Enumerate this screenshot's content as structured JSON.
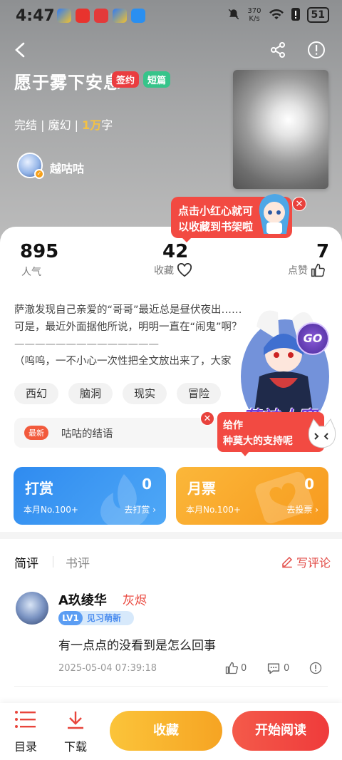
{
  "status_bar": {
    "time": "4:47",
    "net_speed_value": "370",
    "net_speed_unit": "K/s",
    "battery": "51"
  },
  "book": {
    "title": "愿于雾下安息",
    "tag_signed": "签约",
    "tag_short": "短篇",
    "status": "完结",
    "genre": "魔幻",
    "word_count_num": "1万",
    "word_count_unit": "字",
    "author": "越咕咕"
  },
  "stats": {
    "popularity_value": "895",
    "popularity_label": "人气",
    "collect_value": "42",
    "collect_label": "收藏",
    "like_value": "7",
    "like_label": "点赞"
  },
  "tooltip_collect": {
    "line1": "点击小红心就可",
    "line2": "以收藏到书架啦"
  },
  "synopsis": {
    "line1": "萨澈发现自己亲爱的“哥哥”最近总是昼伏夜出……",
    "line2": "可是，最近外面据他所说，明明一直在“闹鬼”啊？",
    "line3": "——————————————",
    "line4": "（呜呜，一不小心一次性把全文放出来了，大家"
  },
  "tags": [
    "西幻",
    "脑洞",
    "现实",
    "冒险"
  ],
  "latest_chapter": {
    "badge": "最新",
    "title": "咕咕的结语"
  },
  "promo": {
    "label": "萌神大赛",
    "go": "GO",
    "tip_line1": "给作",
    "tip_line2": "种莫大的支持呢"
  },
  "reward": {
    "title": "打赏",
    "count": "0",
    "rank": "本月No.100+",
    "action": "去打赏"
  },
  "monthly_ticket": {
    "title": "月票",
    "count": "0",
    "rank": "本月No.100+",
    "action": "去投票"
  },
  "comment_tabs": {
    "short": "简评",
    "book": "书评",
    "write": "写评论"
  },
  "comment": {
    "user": "A玖绫华",
    "level_name": "灰烬",
    "lv": "LV1",
    "lv_title": "见习萌新",
    "text": "有一点点的没看到是怎么回事",
    "time": "2025-05-04 07:39:18",
    "likes": "0",
    "replies": "0"
  },
  "bottom_bar": {
    "toc": "目录",
    "download": "下载",
    "collect": "收藏",
    "start_reading": "开始阅读"
  },
  "colors": {
    "accent_red": "#f24a42",
    "reward_blue": "#2f8bf0",
    "ticket_orange": "#f9a928",
    "collect_yellow": "#f8b52f"
  }
}
